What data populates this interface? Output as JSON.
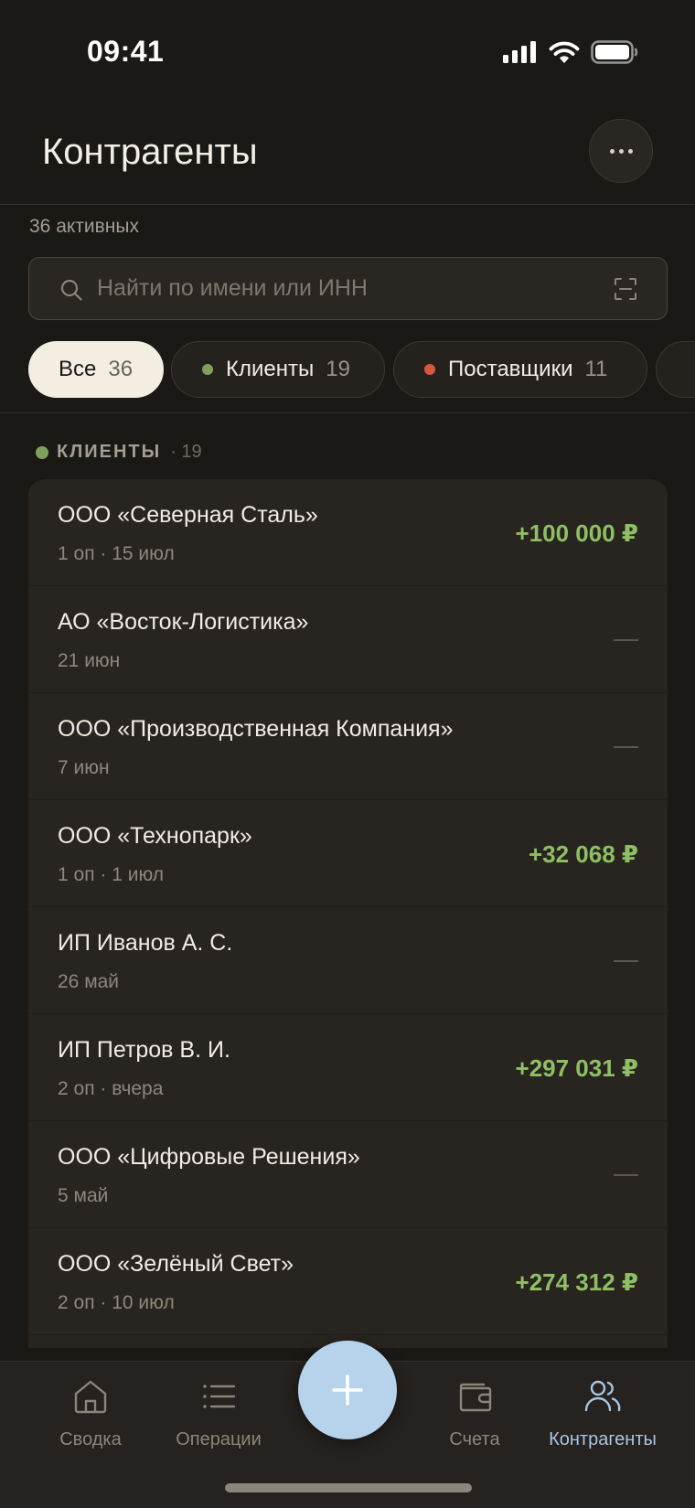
{
  "status_bar": {
    "time": "09:41"
  },
  "header": {
    "title": "Контрагенты",
    "more_icon": "ellipsis-icon"
  },
  "summary": {
    "active_count_text": "36 активных"
  },
  "search": {
    "placeholder": "Найти по имени или ИНН",
    "value": ""
  },
  "chips": [
    {
      "label": "Все",
      "count": "36",
      "active": true
    },
    {
      "label": "Клиенты",
      "count": "19",
      "dot_color": "#7fa05a"
    },
    {
      "label": "Поставщики",
      "count": "11",
      "dot_color": "#d4583b"
    }
  ],
  "section": {
    "title": "КЛИЕНТЫ",
    "count": "· 19",
    "dot_color": "#7fa05a"
  },
  "counterparties": [
    {
      "name": "ООО «Северная Сталь»",
      "meta": "1 оп · 15 июл",
      "amount": "+100 000 ₽"
    },
    {
      "name": "АО «Восток-Логистика»",
      "meta": "21 июн",
      "amount": "—"
    },
    {
      "name": "ООО «Производственная Компания»",
      "meta": "7 июн",
      "amount": "—"
    },
    {
      "name": "ООО «Технопарк»",
      "meta": "1 оп · 1 июл",
      "amount": "+32 068 ₽"
    },
    {
      "name": "ИП Иванов А. С.",
      "meta": "26 май",
      "amount": "—"
    },
    {
      "name": "ИП Петров В. И.",
      "meta": "2 оп · вчера",
      "amount": "+297 031 ₽"
    },
    {
      "name": "ООО «Цифровые Решения»",
      "meta": "5 май",
      "amount": "—"
    },
    {
      "name": "ООО «Зелёный Свет»",
      "meta": "2 оп · 10 июл",
      "amount": "+274 312 ₽"
    }
  ],
  "tabbar": {
    "tabs": [
      {
        "label": "Сводка",
        "icon": "home-icon"
      },
      {
        "label": "Операции",
        "icon": "list-icon"
      },
      {
        "label": "Счета",
        "icon": "wallet-icon"
      },
      {
        "label": "Контрагенты",
        "icon": "users-icon",
        "active": true
      }
    ],
    "fab_icon": "plus-icon"
  },
  "colors": {
    "positive": "#8fbf63",
    "accent": "#b7d3ec",
    "background": "#1b1916"
  }
}
